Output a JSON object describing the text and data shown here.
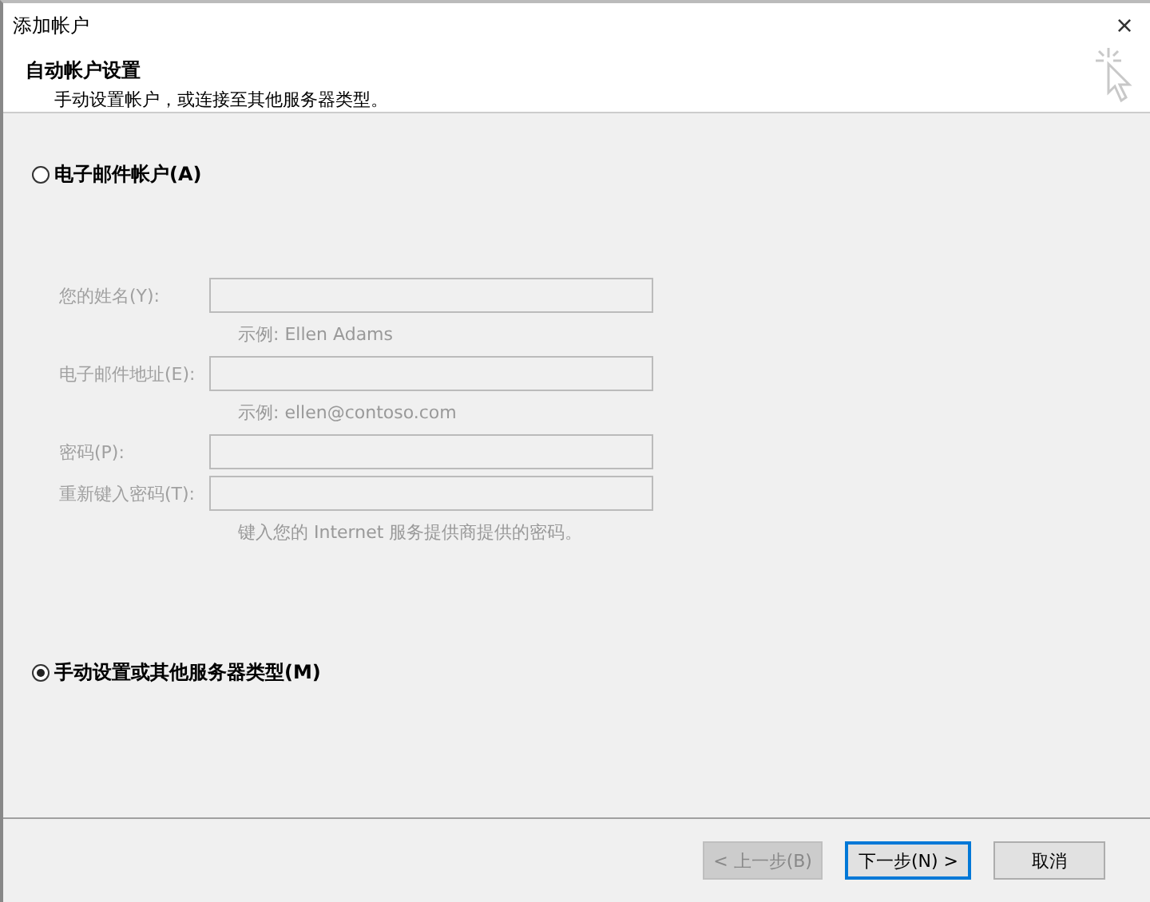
{
  "window": {
    "title": "添加帐户",
    "close": "×"
  },
  "header": {
    "title": "自动帐户设置",
    "subtitle": "手动设置帐户，或连接至其他服务器类型。"
  },
  "options": [
    {
      "label": "电子邮件帐户(A)",
      "selected": false
    },
    {
      "label": "手动设置或其他服务器类型(M)",
      "selected": true
    }
  ],
  "form": {
    "disabled": true,
    "fields": [
      {
        "label": "您的姓名(Y):",
        "hint": "示例: Ellen Adams"
      },
      {
        "label": "电子邮件地址(E):",
        "hint": "示例: ellen@contoso.com"
      },
      {
        "label": "密码(P):"
      },
      {
        "label": "重新键入密码(T):",
        "hint": "键入您的 Internet 服务提供商提供的密码。"
      }
    ]
  },
  "buttons": [
    {
      "label": "< 上一步(B)",
      "disabled": true,
      "default": false
    },
    {
      "label": "下一步(N) >",
      "disabled": false,
      "default": true
    },
    {
      "label": "取消",
      "disabled": false,
      "default": false
    }
  ]
}
